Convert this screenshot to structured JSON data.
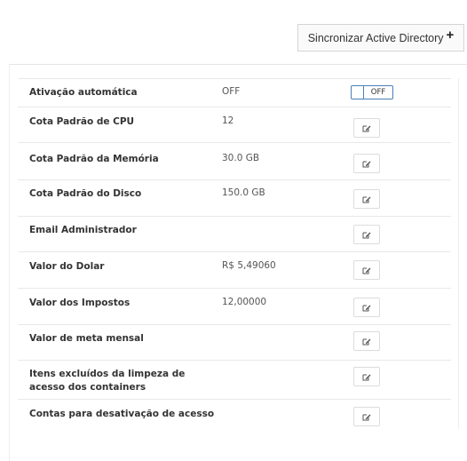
{
  "header": {
    "sync_button_label": "Sincronizar Active Directory",
    "sync_button_icon": "plus-icon"
  },
  "settings": [
    {
      "label": "Ativação automática",
      "value": "OFF",
      "control": "toggle",
      "toggle_state": "OFF"
    },
    {
      "label": "Cota Padrão de CPU",
      "value": "12",
      "control": "edit"
    },
    {
      "label": "Cota Padrão da Memória",
      "value": "30.0 GB",
      "control": "edit"
    },
    {
      "label": "Cota Padrão do Disco",
      "value": "150.0 GB",
      "control": "edit"
    },
    {
      "label": "Email Administrador",
      "value": "",
      "control": "edit"
    },
    {
      "label": "Valor do Dolar",
      "value": "R$ 5,49060",
      "control": "edit"
    },
    {
      "label": "Valor dos Impostos",
      "value": "12,00000",
      "control": "edit"
    },
    {
      "label": "Valor de meta mensal",
      "value": "",
      "control": "edit"
    },
    {
      "label_line1": "Itens excluídos da limpeza de",
      "label_line2": "acesso dos containers",
      "value": "",
      "control": "edit"
    },
    {
      "label": "Contas para desativação de acesso",
      "value": "",
      "control": "edit"
    }
  ],
  "edit_icon": "edit-icon",
  "colors": {
    "toggle_border": "#4a7fb8",
    "row_divider": "#e8e8e8"
  }
}
